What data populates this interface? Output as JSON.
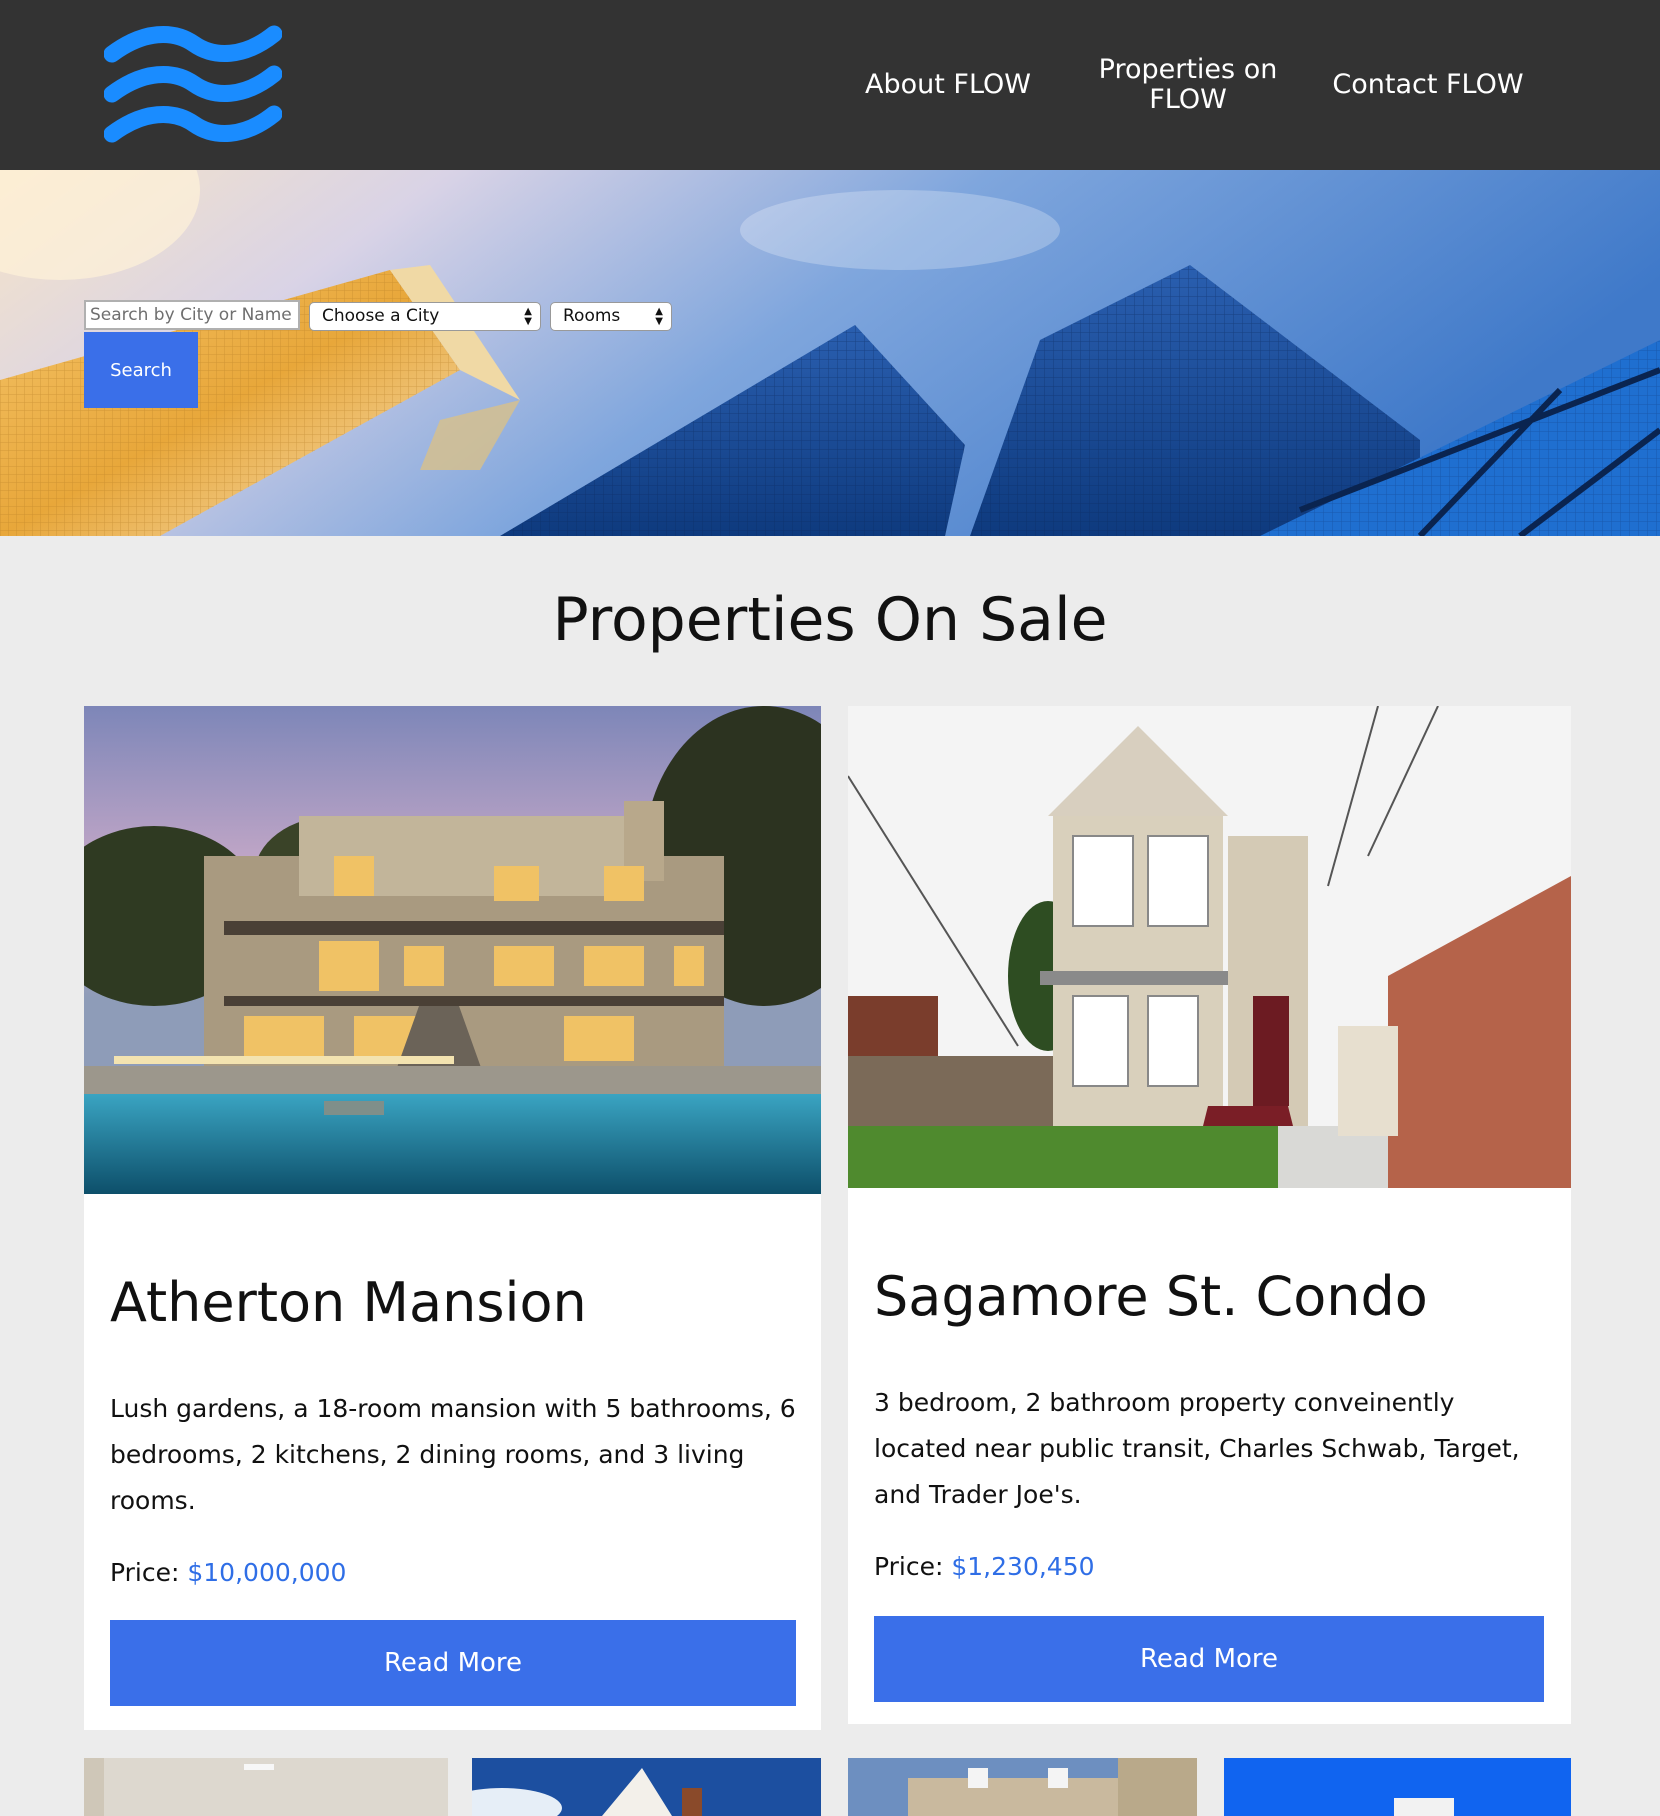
{
  "nav": {
    "about": "About FLOW",
    "properties": "Properties on FLOW",
    "contact": "Contact FLOW"
  },
  "search": {
    "placeholder": "Search by City or Name",
    "city_select": "Choose a City",
    "rooms_select": "Rooms",
    "button": "Search"
  },
  "section_title": "Properties On Sale",
  "price_label": "Price:",
  "properties": [
    {
      "title": "Atherton Mansion",
      "description": "Lush gardens, a 18-room mansion with 5 bathrooms, 6 bedrooms, 2 kitchens, 2 dining rooms, and 3 living rooms.",
      "price": "$10,000,000",
      "button": "Read More"
    },
    {
      "title": "Sagamore St. Condo",
      "description": "3 bedroom, 2 bathroom property conveinently located near public transit, Charles Schwab, Target, and Trader Joe's.",
      "price": "$1,230,450",
      "button": "Read More"
    }
  ],
  "colors": {
    "header_bg": "#333333",
    "accent": "#3a6fe9",
    "price": "#2f6ee6",
    "page_bg": "#ececec",
    "logo": "#1a8cff"
  }
}
